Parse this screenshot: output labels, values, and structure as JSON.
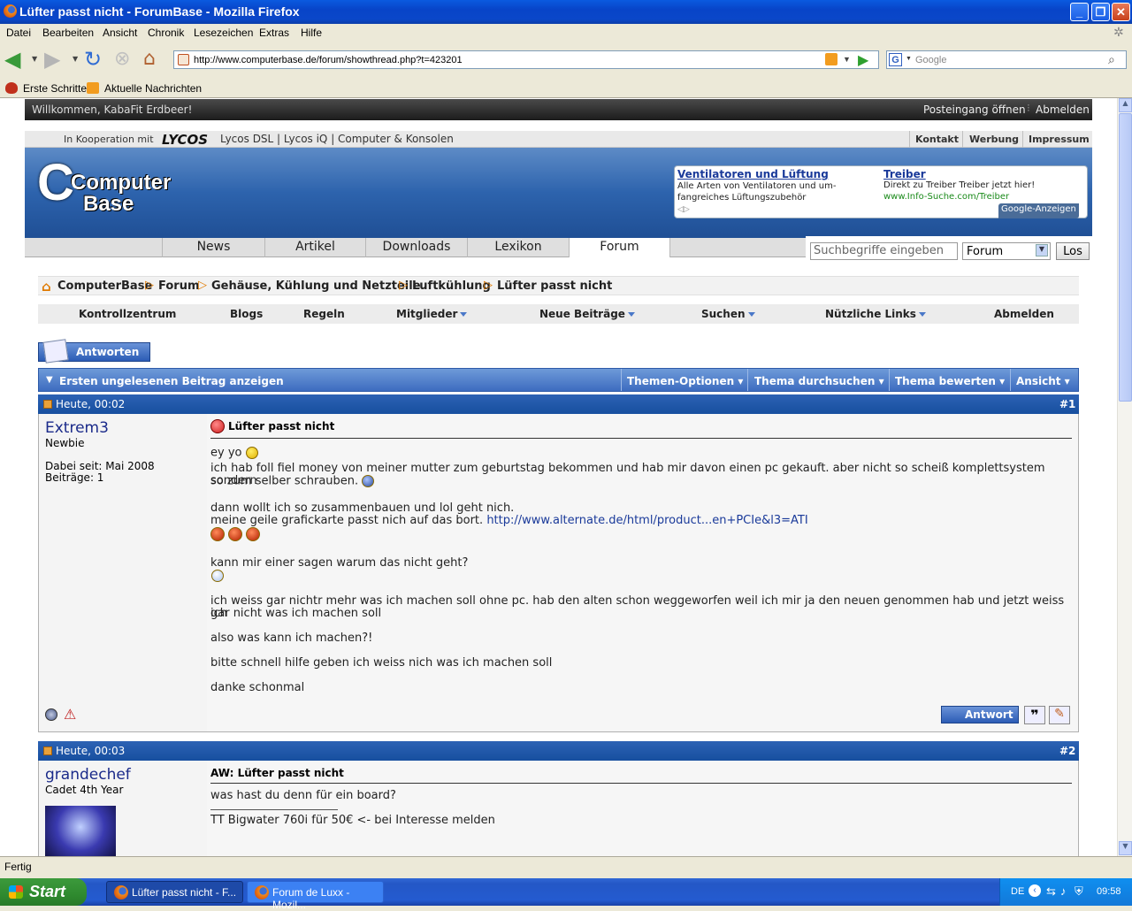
{
  "window": {
    "title": "Lüfter passt nicht - ForumBase - Mozilla Firefox"
  },
  "menu": [
    "Datei",
    "Bearbeiten",
    "Ansicht",
    "Chronik",
    "Lesezeichen",
    "Extras",
    "Hilfe"
  ],
  "url": "http://www.computerbase.de/forum/showthread.php?t=423201",
  "search_placeholder": "Google",
  "bookmarks": [
    "Erste Schritte",
    "Aktuelle Nachrichten"
  ],
  "status": "Fertig",
  "taskbar": {
    "start": "Start",
    "tasks": [
      "Lüfter passt nicht - F...",
      "Forum de Luxx - Mozil..."
    ],
    "lang": "DE",
    "clock": "09:58"
  },
  "page": {
    "welcome": "Willkommen, KabaFit Erdbeer!",
    "top_links": [
      "Posteingang öffnen",
      "Abmelden"
    ],
    "coop_prefix": "In Kooperation mit",
    "coop_brand": "LYCOS",
    "coop_links": "Lycos DSL | Lycos iQ | Computer & Konsolen",
    "coop_right": [
      "Kontakt",
      "Werbung",
      "Impressum"
    ],
    "logo": {
      "line1": "Computer",
      "line2": "Base"
    },
    "ads": [
      {
        "title": "Ventilatoren und Lüftung",
        "text": "Alle Arten von Ventilatoren und um- fangreiches Lüftungszubehör"
      },
      {
        "title": "Treiber",
        "text": "Direkt zu Treiber Treiber jetzt hier!",
        "url": "www.Info-Suche.com/Treiber"
      }
    ],
    "ads_label": "Google-Anzeigen",
    "nav_tabs": [
      "News",
      "Artikel",
      "Downloads",
      "Lexikon",
      "Forum"
    ],
    "site_search": {
      "placeholder": "Suchbegriffe eingeben",
      "scope": "Forum",
      "button": "Los"
    },
    "breadcrumb": [
      "ComputerBase",
      "Forum",
      "Gehäuse, Kühlung und Netzteile",
      "Luftkühlung",
      "Lüfter passt nicht"
    ],
    "forum_nav": [
      "Kontrollzentrum",
      "Blogs",
      "Regeln",
      "Mitglieder",
      "Neue Beiträge",
      "Suchen",
      "Nützliche Links",
      "Abmelden"
    ],
    "reply_button": "Antworten",
    "thread_bar": {
      "first_unread": "Ersten ungelesenen Beitrag anzeigen",
      "options": [
        "Themen-Optionen",
        "Thema durchsuchen",
        "Thema bewerten",
        "Ansicht"
      ]
    },
    "posts": [
      {
        "date": "Heute, 00:02",
        "num": "#1",
        "user": "Extrem3",
        "rank": "Newbie",
        "joined": "Dabei seit: Mai 2008",
        "count": "Beiträge: 1",
        "title": "Lüfter passt nicht",
        "lines": [
          "ey yo",
          "ich hab foll fiel money von meiner mutter zum geburtstag bekommen und hab mir davon einen pc gekauft. aber nicht so scheiß komplettsystem sondern",
          "so zum selber schrauben.",
          "dann wollt ich so zusammenbauen und lol geht nich.",
          "meine geile grafickarte passt nich auf das bort.",
          "kann mir einer sagen warum das nicht geht?",
          "ich weiss gar nichtr mehr was ich machen soll ohne pc. hab den alten schon weggeworfen weil ich mir ja den neuen genommen hab und jetzt weiss ich",
          "gar nicht was ich machen soll",
          "also was kann ich machen?!",
          "bitte schnell hilfe geben ich weiss nich was ich machen soll",
          "danke schonmal"
        ],
        "link": "http://www.alternate.de/html/product...en+PCIe&l3=ATI",
        "reply_label": "Antwort"
      },
      {
        "date": "Heute, 00:03",
        "num": "#2",
        "user": "grandechef",
        "rank": "Cadet 4th Year",
        "title": "AW: Lüfter passt nicht",
        "lines": [
          "was hast du denn für ein board?"
        ],
        "signature": "TT Bigwater 760i für 50€ <- bei Interesse melden"
      }
    ]
  }
}
